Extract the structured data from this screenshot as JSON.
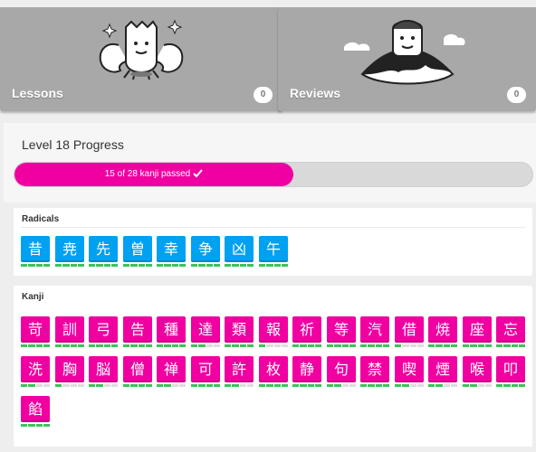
{
  "cards": {
    "lessons": {
      "label": "Lessons",
      "count": "0"
    },
    "reviews": {
      "label": "Reviews",
      "count": "0"
    }
  },
  "progress": {
    "title": "Level 18 Progress",
    "text": "15 of 28 kanji passed",
    "fraction": 0.536
  },
  "radicals": {
    "title": "Radicals",
    "items": [
      {
        "char": "昔",
        "level": 4
      },
      {
        "char": "尭",
        "level": 4
      },
      {
        "char": "先",
        "level": 4
      },
      {
        "char": "曽",
        "level": 4
      },
      {
        "char": "幸",
        "level": 4
      },
      {
        "char": "争",
        "level": 4
      },
      {
        "char": "凶",
        "level": 4
      },
      {
        "char": "午",
        "level": 4
      }
    ]
  },
  "kanji": {
    "title": "Kanji",
    "items": [
      {
        "char": "苛",
        "level": 4
      },
      {
        "char": "訓",
        "level": 4
      },
      {
        "char": "弓",
        "level": 4
      },
      {
        "char": "告",
        "level": 4
      },
      {
        "char": "種",
        "level": 4
      },
      {
        "char": "達",
        "level": 2
      },
      {
        "char": "類",
        "level": 4
      },
      {
        "char": "報",
        "level": 1
      },
      {
        "char": "祈",
        "level": 4
      },
      {
        "char": "等",
        "level": 4
      },
      {
        "char": "汽",
        "level": 4
      },
      {
        "char": "借",
        "level": 1
      },
      {
        "char": "焼",
        "level": 4
      },
      {
        "char": "座",
        "level": 4
      },
      {
        "char": "忘",
        "level": 4
      },
      {
        "char": "洗",
        "level": 2
      },
      {
        "char": "胸",
        "level": 1
      },
      {
        "char": "脳",
        "level": 2
      },
      {
        "char": "僧",
        "level": 4
      },
      {
        "char": "禅",
        "level": 2
      },
      {
        "char": "可",
        "level": 4
      },
      {
        "char": "許",
        "level": 2
      },
      {
        "char": "枚",
        "level": 4
      },
      {
        "char": "静",
        "level": 4
      },
      {
        "char": "句",
        "level": 2
      },
      {
        "char": "禁",
        "level": 4
      },
      {
        "char": "喫",
        "level": 2
      },
      {
        "char": "煙",
        "level": 2
      },
      {
        "char": "喉",
        "level": 2
      },
      {
        "char": "叩",
        "level": 4
      },
      {
        "char": "餡",
        "level": 4
      }
    ]
  },
  "colors": {
    "radical": "#00a1f1",
    "kanji": "#f100a1",
    "srs_pip": "#3ac45a"
  }
}
